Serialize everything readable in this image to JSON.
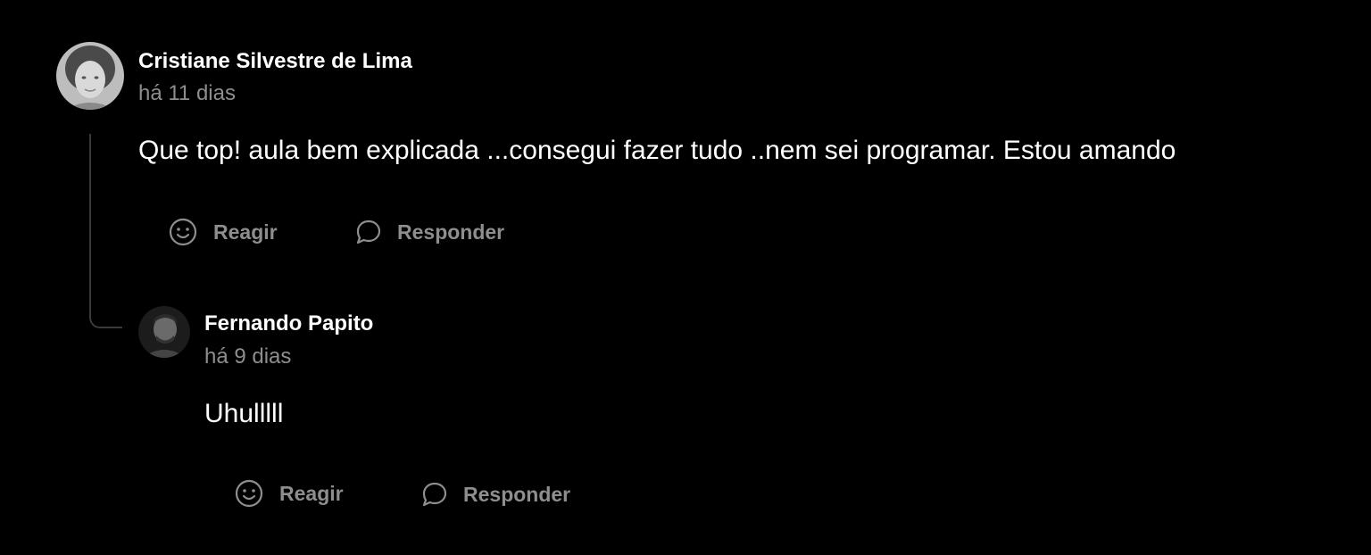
{
  "comment": {
    "author": "Cristiane Silvestre de Lima",
    "time": "há 11 dias",
    "text": "Que top! aula bem explicada ...consegui fazer tudo ..nem sei programar. Estou amando",
    "actions": {
      "react_label": "Reagir",
      "reply_label": "Responder",
      "react_icon": "smiley-icon",
      "reply_icon": "speech-bubble-icon"
    },
    "reply": {
      "author": "Fernando Papito",
      "time": "há 9 dias",
      "text": "Uhulllll",
      "actions": {
        "react_label": "Reagir",
        "reply_label": "Responder",
        "react_icon": "smiley-icon",
        "reply_icon": "speech-bubble-icon"
      }
    }
  },
  "colors": {
    "background": "#000000",
    "text_primary": "#ffffff",
    "text_secondary": "#8e8e8e",
    "connector": "#3a3a3a"
  }
}
